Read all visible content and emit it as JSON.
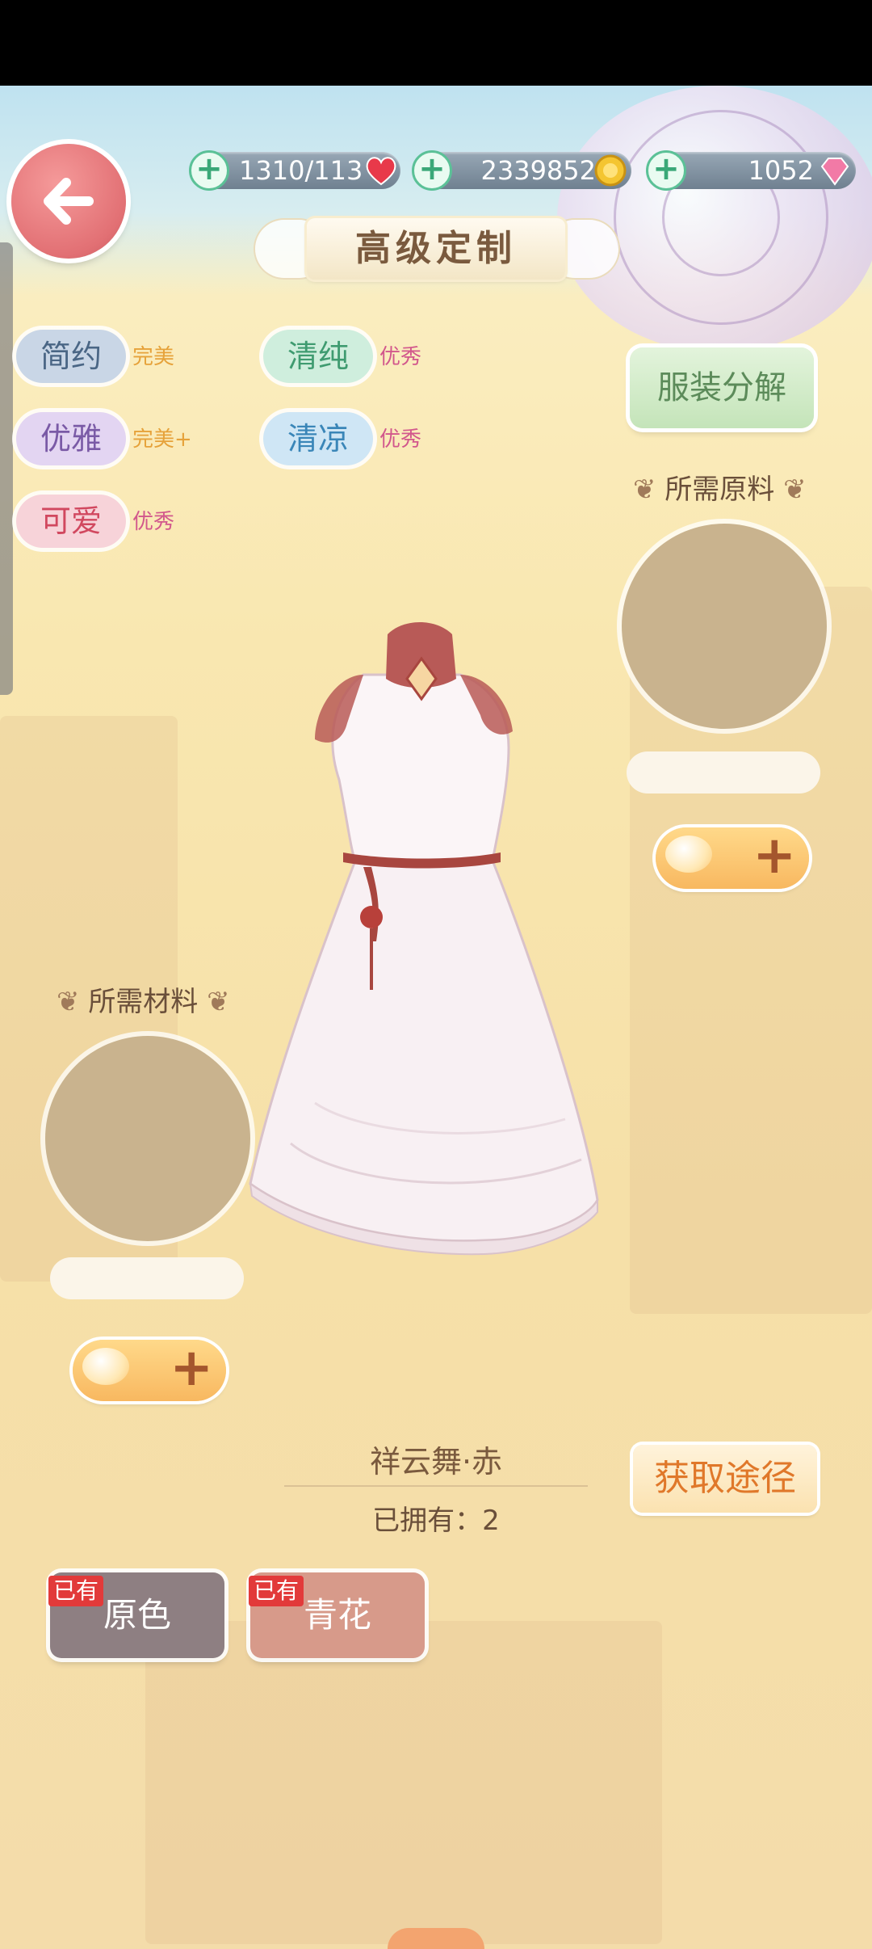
{
  "header": {
    "stamina": "1310/113",
    "gold": "2339852",
    "diamonds": "1052",
    "title": "高级定制"
  },
  "styles": [
    {
      "name": "简约",
      "grade": "完美",
      "bg": "#c9d6e6",
      "fg": "#4a6685",
      "gradeColor": "#e6a23a"
    },
    {
      "name": "清纯",
      "grade": "优秀",
      "bg": "#cfeedd",
      "fg": "#3f9b70",
      "gradeColor": "#d2578c"
    },
    {
      "name": "优雅",
      "grade": "完美+",
      "bg": "#e3d5f2",
      "fg": "#7a5aa6",
      "gradeColor": "#e6a23a"
    },
    {
      "name": "清凉",
      "grade": "优秀",
      "bg": "#cfe6f5",
      "fg": "#3a86b8",
      "gradeColor": "#d2578c"
    },
    {
      "name": "可爱",
      "grade": "优秀",
      "bg": "#f7d3d9",
      "fg": "#d1485f",
      "gradeColor": "#d2578c"
    }
  ],
  "actions": {
    "decompose": "服装分解",
    "source": "获取途径"
  },
  "materials": {
    "raw_label": "所需原料",
    "material_label": "所需材料"
  },
  "item": {
    "name": "祥云舞·赤",
    "owned": "已拥有：2"
  },
  "colors": [
    {
      "label": "原色",
      "tag": "已有",
      "bg": "#8e7f82"
    },
    {
      "label": "青花",
      "tag": "已有",
      "bg": "#d79a8a"
    }
  ]
}
